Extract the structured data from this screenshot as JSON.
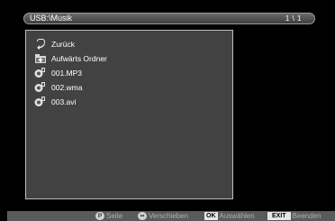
{
  "header": {
    "path": "USB:\\Musik",
    "page": "1 \\ 1"
  },
  "file_list": {
    "items": [
      {
        "label": "Zurück",
        "icon": "back-arrow-icon"
      },
      {
        "label": "Aufwärts Ordner",
        "icon": "folder-up-icon"
      },
      {
        "label": "001.MP3",
        "icon": "file-icon"
      },
      {
        "label": "002.wma",
        "icon": "file-icon"
      },
      {
        "label": "003.avi",
        "icon": "file-icon"
      }
    ]
  },
  "footer": {
    "page_key": "P",
    "page_label": "Seite",
    "move_key": "••",
    "move_label": "Verschieben",
    "ok_key": "OK",
    "ok_label": "Auswählen",
    "exit_key": "EXIT",
    "exit_label": "Beenden"
  }
}
